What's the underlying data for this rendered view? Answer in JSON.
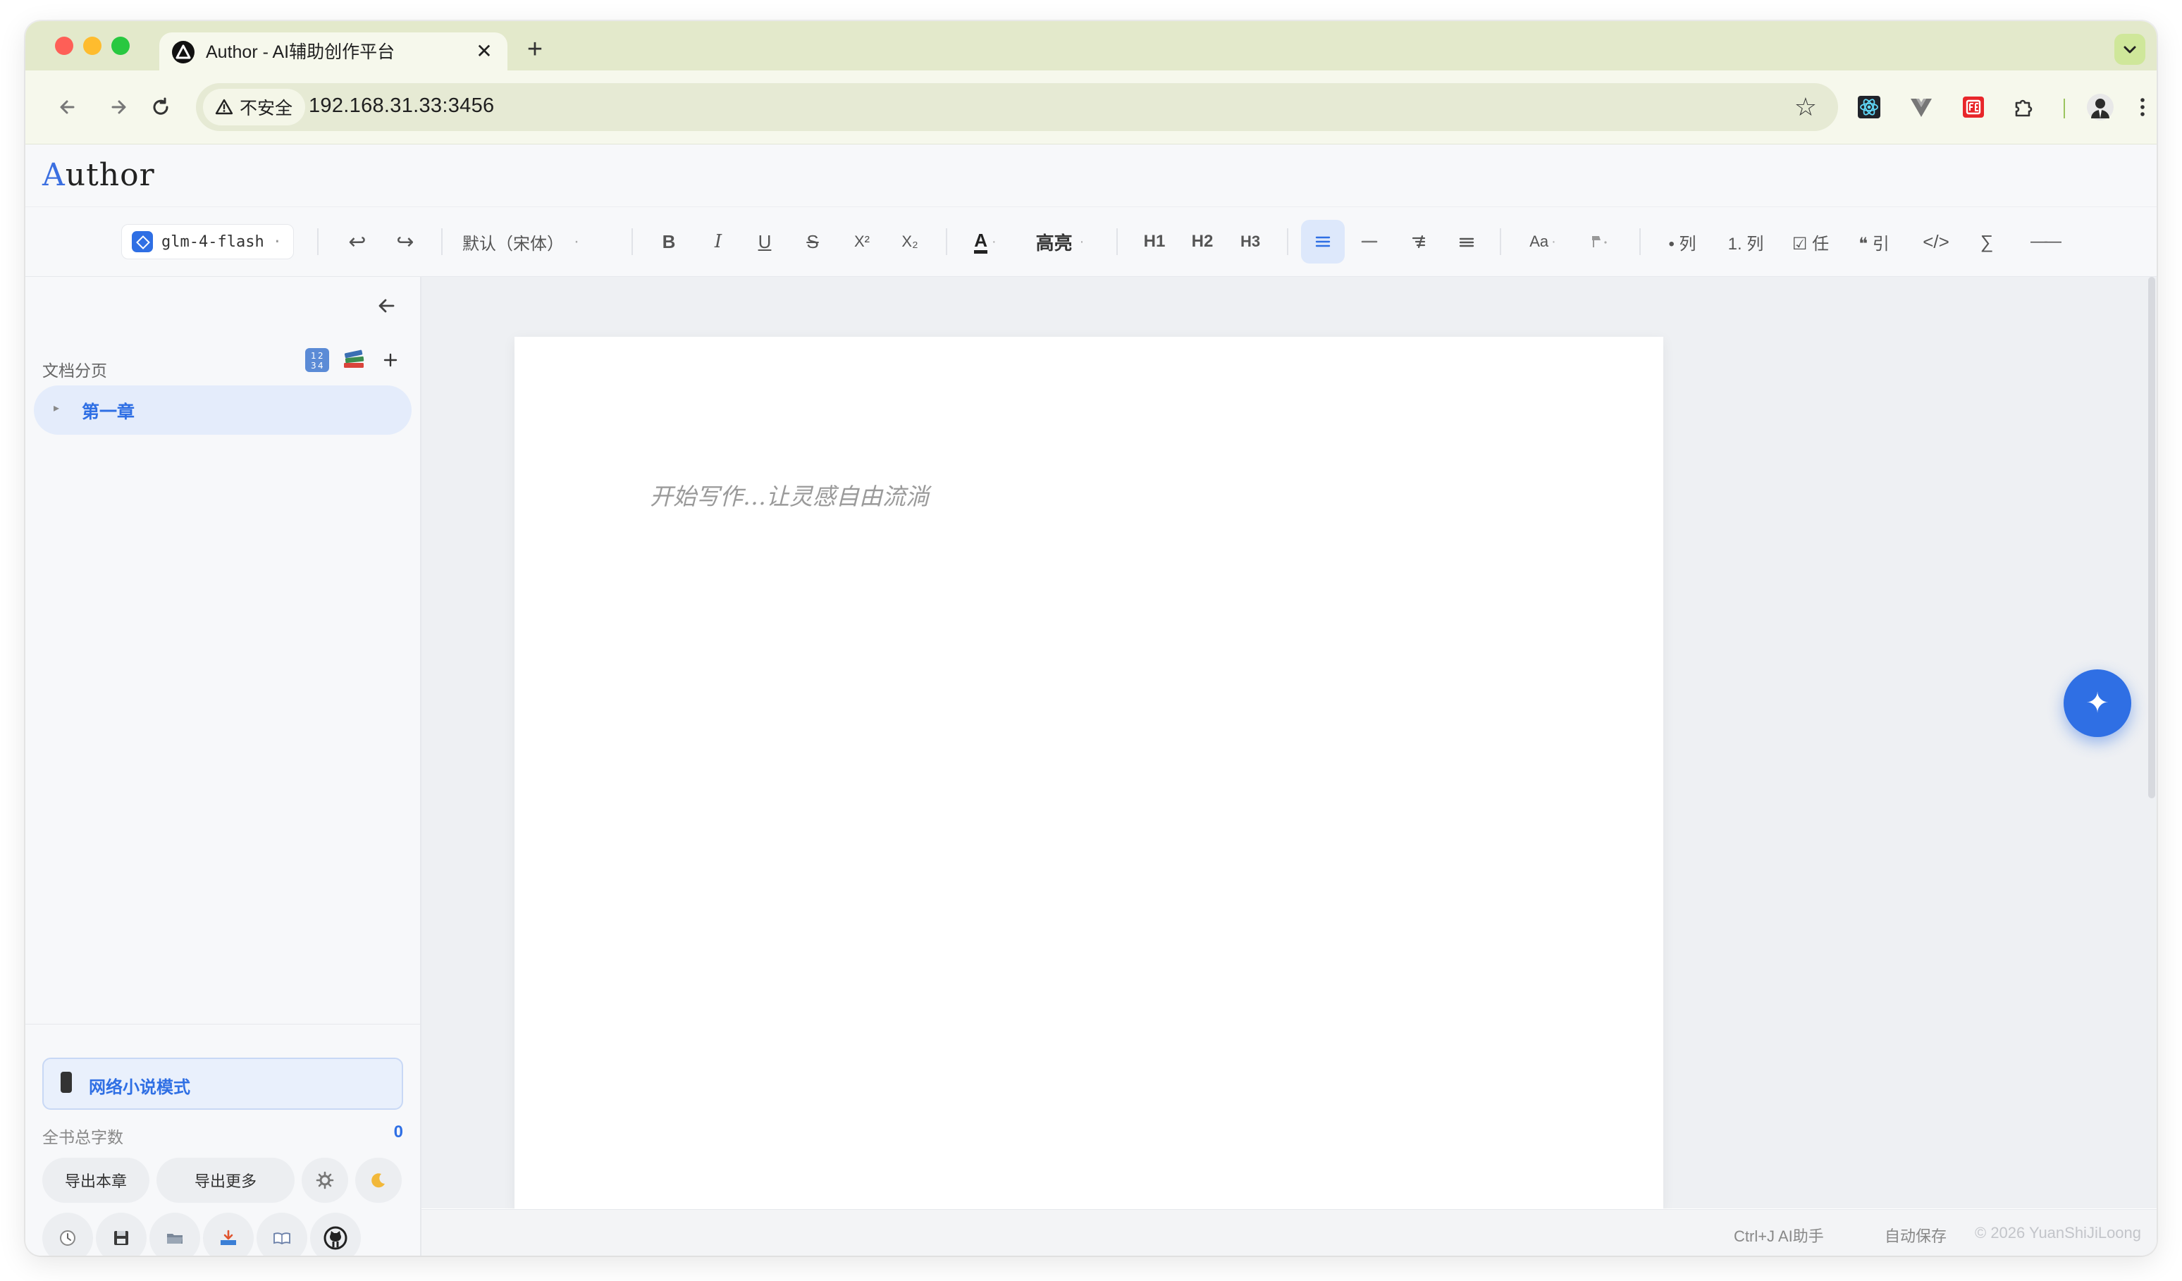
{
  "browser": {
    "tab_title": "Author - AI辅助创作平台",
    "close_glyph": "✕",
    "new_tab_glyph": "+",
    "security_label": "不安全",
    "url": "192.168.31.33:3456"
  },
  "app": {
    "logo_first": "A",
    "logo_rest": "uthor"
  },
  "toolbar": {
    "model": "glm-4-flash",
    "model_caret": "·",
    "undo": "↩",
    "redo": "↪",
    "font": "默认（宋体）",
    "font_caret": "·",
    "bold": "B",
    "italic": "I",
    "underline": "U",
    "strike": "S",
    "superscript": "X²",
    "subscript": "X₂",
    "text_color": "A",
    "text_color_caret": "·",
    "highlight": "高亮",
    "highlight_caret": "·",
    "h1": "H1",
    "h2": "H2",
    "h3": "H3",
    "font_size": "Aa",
    "font_size_caret": "·",
    "bullet_list": "• 列",
    "ordered_list": "1. 列",
    "task_list": "☑ 任",
    "quote": "❝ 引",
    "code": "</>",
    "formula": "∑",
    "hr": "——"
  },
  "sidebar": {
    "section_label": "文档分页",
    "chapters": [
      {
        "label": "第一章",
        "caret": "▸"
      }
    ],
    "mode_button": "网络小说模式",
    "word_count_label": "全书总字数",
    "word_count": "0",
    "export_chapter": "导出本章",
    "export_more": "导出更多"
  },
  "editor": {
    "placeholder": "开始写作…让灵感自由流淌"
  },
  "status_bar": {
    "shortcut": "Ctrl+J AI助手",
    "autosave": "自动保存",
    "copyright": "© 2026 YuanShiJiLoong"
  },
  "colors": {
    "accent": "#2f6fe4",
    "tab_strip": "#e3e9cb",
    "toolbar_bg": "#f6f8ec"
  }
}
